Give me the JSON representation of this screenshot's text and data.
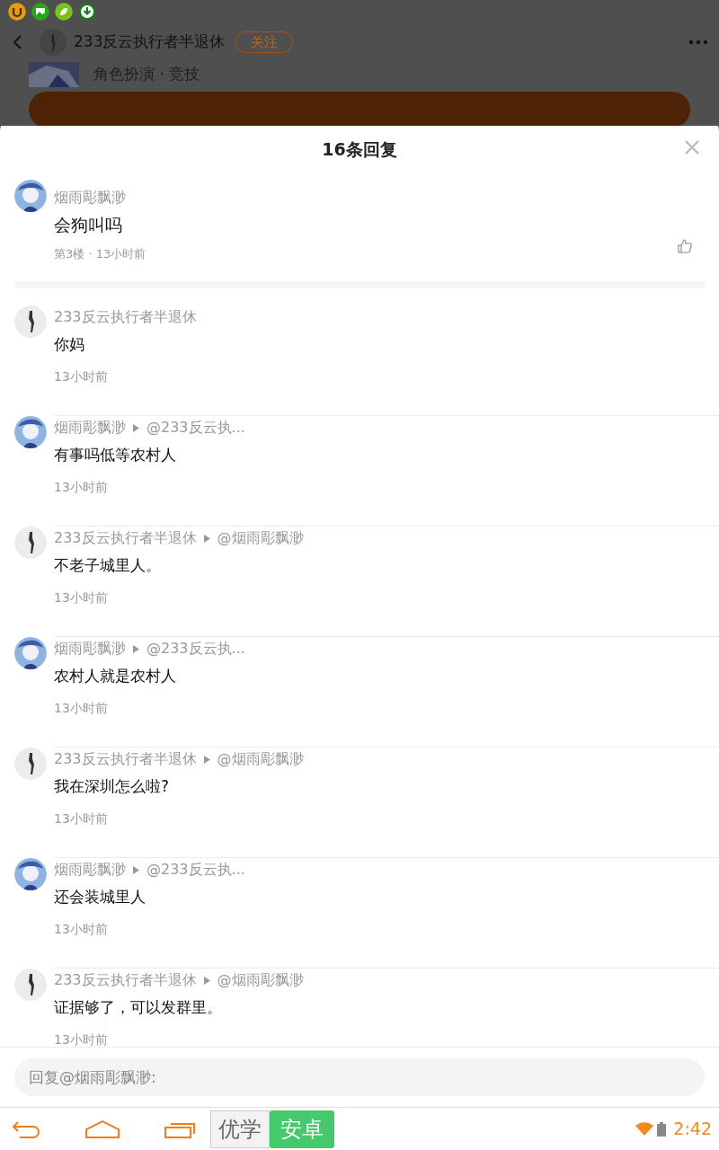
{
  "background": {
    "user": "233反云执行者半退休",
    "follow": "关注",
    "game_tags": "角色扮演 · 竞技"
  },
  "sheet": {
    "title": "16条回复",
    "main_comment": {
      "kind": "anime",
      "name": "烟雨彫飘渺",
      "text": "会狗叫吗",
      "meta": "第3楼 · 13小时前"
    },
    "replies": [
      {
        "kind": "figure",
        "name": "233反云执行者半退休",
        "text": "你妈",
        "time": "13小时前"
      },
      {
        "kind": "anime",
        "name": "烟雨彫飘渺",
        "target": "@233反云执...",
        "text": "有事吗低等农村人",
        "time": "13小时前"
      },
      {
        "kind": "figure",
        "name": "233反云执行者半退休",
        "target": "@烟雨彫飘渺",
        "text": "不老子城里人。",
        "time": "13小时前"
      },
      {
        "kind": "anime",
        "name": "烟雨彫飘渺",
        "target": "@233反云执...",
        "text": "农村人就是农村人",
        "time": "13小时前"
      },
      {
        "kind": "figure",
        "name": "233反云执行者半退休",
        "target": "@烟雨彫飘渺",
        "text": "我在深圳怎么啦?",
        "time": "13小时前"
      },
      {
        "kind": "anime",
        "name": "烟雨彫飘渺",
        "target": "@233反云执...",
        "text": "还会装城里人",
        "time": "13小时前"
      },
      {
        "kind": "figure",
        "name": "233反云执行者半退休",
        "target": "@烟雨彫飘渺",
        "text": "证据够了，可以发群里。",
        "time": "13小时前"
      }
    ],
    "reply_field": {
      "placeholder": "回复@烟雨彫飘渺:"
    }
  },
  "navbar": {
    "app_label": "优学",
    "app_label_2": "安卓",
    "time": "2:42"
  }
}
